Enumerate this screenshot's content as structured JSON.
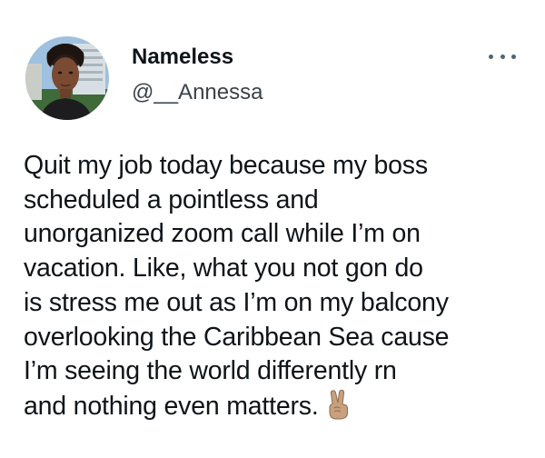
{
  "author": {
    "display_name": "Nameless",
    "handle": "@__Annessa",
    "avatar_icon": "profile-photo"
  },
  "menu": {
    "icon": "more-options-icon"
  },
  "tweet": {
    "lines": [
      "Quit my job today because my boss",
      "scheduled a pointless and",
      "unorganized zoom call while I’m on",
      "vacation. Like, what you not gon do",
      "is stress me out as I’m on my balcony",
      "overlooking the Caribbean Sea cause",
      "I’m seeing the world differently rn",
      "and nothing even matters."
    ],
    "emoji": "victory-hand-medium-skin-tone"
  },
  "colors": {
    "text": "#0f1419",
    "secondary_text": "#3b4249",
    "icon": "#536471"
  }
}
